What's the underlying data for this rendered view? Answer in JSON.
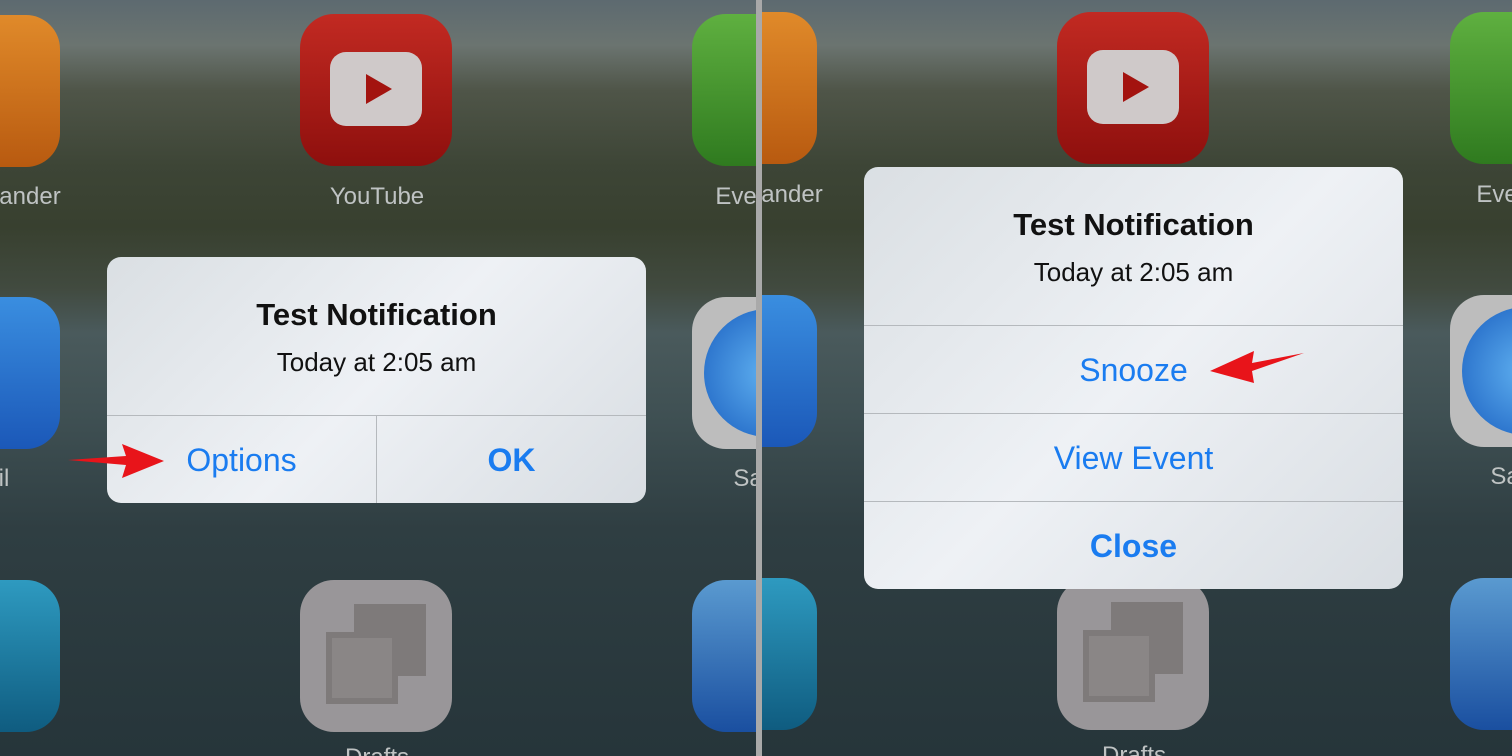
{
  "left": {
    "apps": [
      {
        "label": "ander"
      },
      {
        "label": "YouTube"
      },
      {
        "label": "Eve"
      },
      {
        "label": "il"
      },
      {
        "label": "Sa"
      },
      {
        "label": "Drafts"
      }
    ],
    "alert": {
      "title": "Test Notification",
      "subtitle": "Today at 2:05 am",
      "buttons": [
        "Options",
        "OK"
      ]
    }
  },
  "right": {
    "apps": [
      {
        "label": "ander"
      },
      {
        "label": "Eve"
      },
      {
        "label": "Sa"
      },
      {
        "label": "Drafts"
      }
    ],
    "alert": {
      "title": "Test Notification",
      "subtitle": "Today at 2:05 am",
      "buttons": [
        "Snooze",
        "View Event",
        "Close"
      ]
    }
  },
  "colors": {
    "accent": "#1a7cf0",
    "arrow": "#e8141a"
  }
}
